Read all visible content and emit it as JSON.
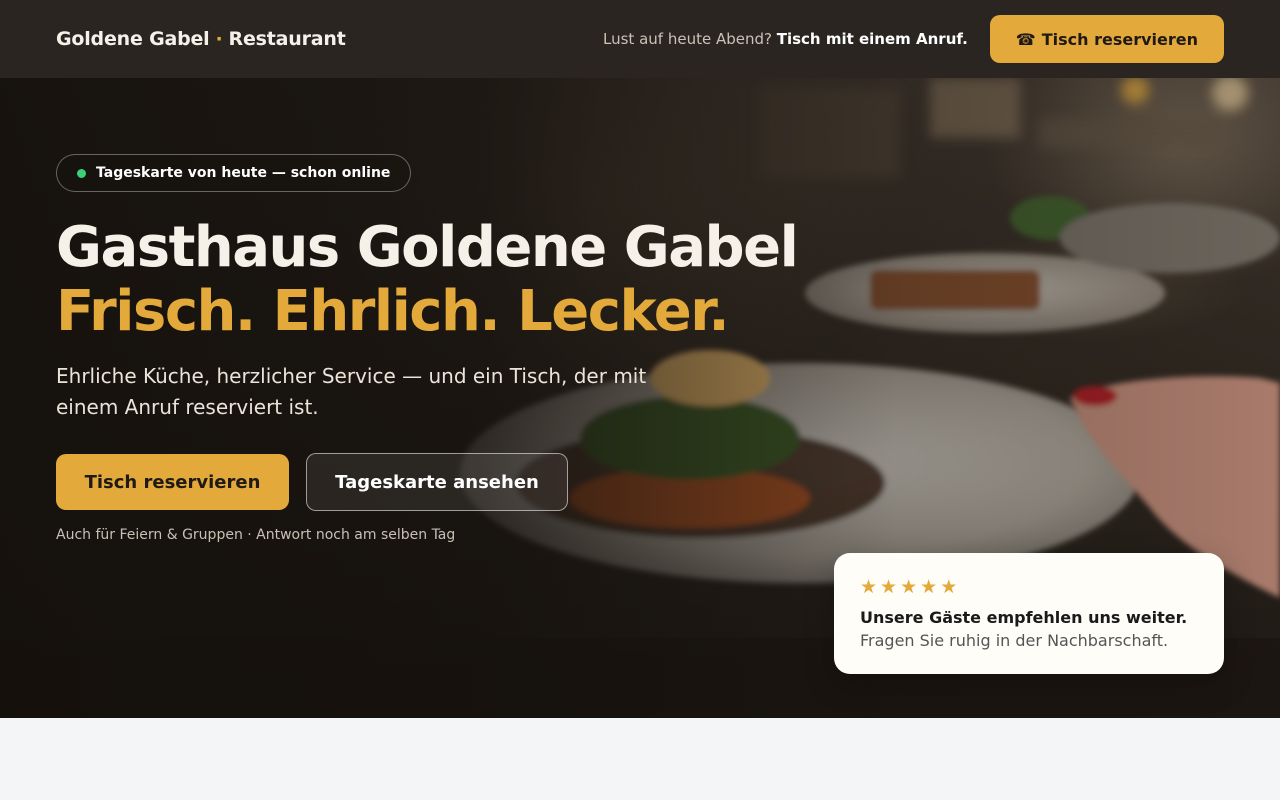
{
  "header": {
    "brand_name": "Goldene Gabel",
    "brand_separator": "·",
    "brand_suffix": "Restaurant",
    "tagline_prefix": "Lust auf heute Abend?",
    "tagline_bold": "Tisch mit einem Anruf.",
    "reserve_icon": "☎",
    "reserve_label": "Tisch reservieren"
  },
  "hero": {
    "badge_text": "Tageskarte von heute — schon online",
    "title": "Gasthaus Goldene Gabel",
    "title_accent": "Frisch. Ehrlich. Lecker.",
    "lead": "Ehrliche Küche, herzlicher Service — und ein Tisch, der mit einem Anruf reserviert ist.",
    "primary_button": "Tisch reservieren",
    "secondary_button": "Tageskarte ansehen",
    "note": "Auch für Feiern & Gruppen · Antwort noch am selben Tag"
  },
  "review": {
    "stars": [
      "★",
      "★",
      "★",
      "★",
      "★"
    ],
    "rating": 5,
    "title": "Unsere Gäste empfehlen uns weiter.",
    "subtitle": "Fragen Sie ruhig in der Nachbarschaft."
  },
  "colors": {
    "accent": "#e4a93b",
    "header_bg": "#2a2521",
    "status_dot": "#3ccf7a"
  },
  "icons": {
    "reserve": "phone-icon",
    "badge": "status-dot-icon",
    "rating": "star-icon"
  }
}
